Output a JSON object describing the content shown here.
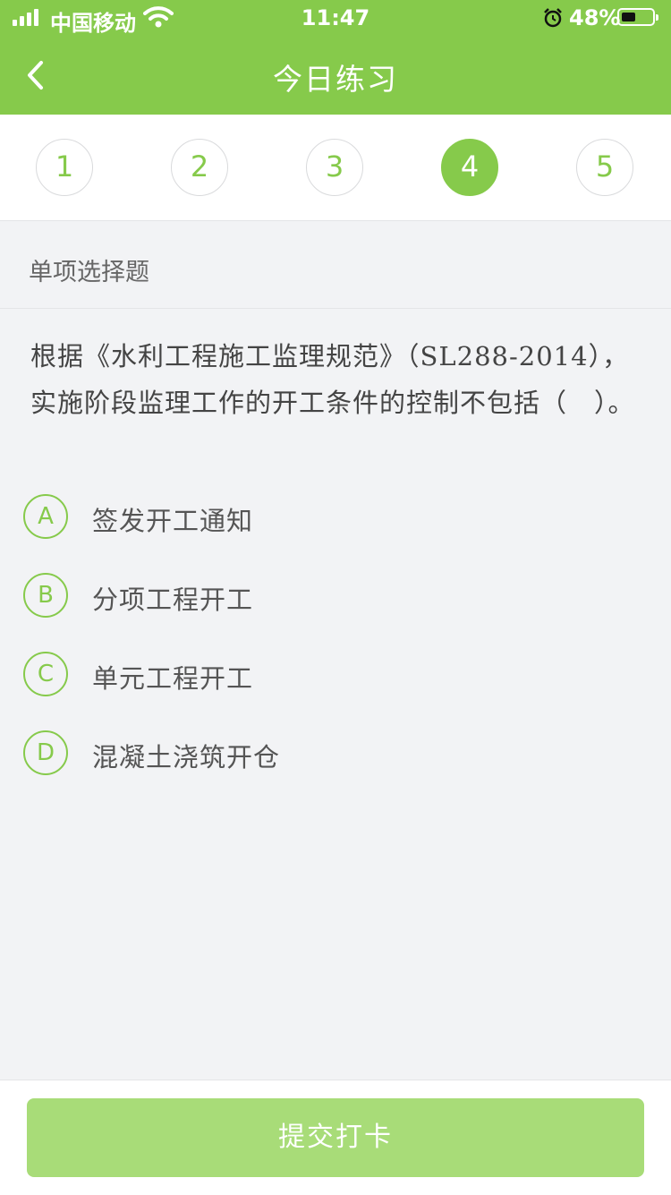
{
  "status_bar": {
    "carrier": "中国移动",
    "time": "11:47",
    "battery_percent": "48%",
    "battery_level": 0.48,
    "icons": [
      "signal-icon",
      "wifi-icon",
      "alarm-icon",
      "battery-icon"
    ]
  },
  "nav": {
    "title": "今日练习",
    "back_icon": "chevron-left-icon"
  },
  "steps": {
    "items": [
      "1",
      "2",
      "3",
      "4",
      "5"
    ],
    "active_index": 3
  },
  "question": {
    "type_label": "单项选择题",
    "text": "根据《水利工程施工监理规范》（SL288-2014），实施阶段监理工作的开工条件的控制不包括（　）。",
    "options": [
      {
        "letter": "A",
        "text": "签发开工通知"
      },
      {
        "letter": "B",
        "text": "分项工程开工"
      },
      {
        "letter": "C",
        "text": "单元工程开工"
      },
      {
        "letter": "D",
        "text": "混凝土浇筑开仓"
      }
    ]
  },
  "footer": {
    "submit_label": "提交打卡"
  },
  "colors": {
    "brand_green": "#86ca4b",
    "button_disabled_green": "#a8dc78",
    "page_background": "#f2f3f5"
  }
}
